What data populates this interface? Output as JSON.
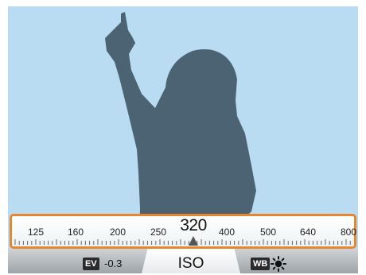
{
  "iso_dial": {
    "current_value": "320",
    "scale_labels": [
      "125",
      "160",
      "200",
      "250",
      "400",
      "500",
      "640",
      "800"
    ],
    "pointer_icon": "triangle-pointer-icon",
    "accent_color": "#e8862e"
  },
  "bottom_bar": {
    "ev_badge": "EV",
    "ev_value": "-0.3",
    "mode_label": "ISO",
    "wb_badge": "WB",
    "wb_icon": "sun-icon"
  },
  "viewfinder": {
    "background_color": "#b9dcf2",
    "subject_color": "#4c6374"
  }
}
